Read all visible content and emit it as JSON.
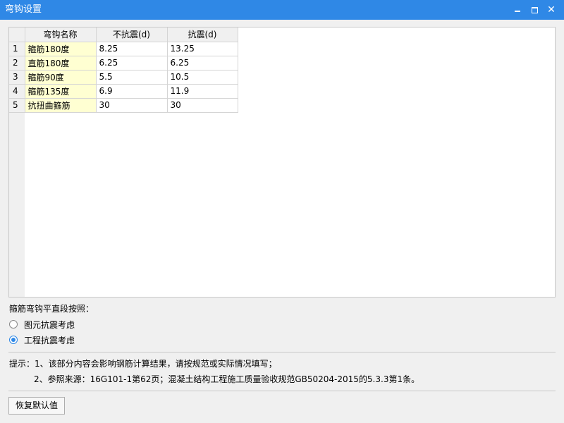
{
  "window": {
    "title": "弯钩设置",
    "minimize_icon": "minimize-icon",
    "maximize_icon": "maximize-icon",
    "close_icon": "close-icon",
    "close_glyph": "✕"
  },
  "table": {
    "columns": [
      "弯钩名称",
      "不抗震(d)",
      "抗震(d)"
    ],
    "rows": [
      {
        "no": "1",
        "name": "箍筋180度",
        "nonseismic": "8.25",
        "seismic": "13.25"
      },
      {
        "no": "2",
        "name": "直筋180度",
        "nonseismic": "6.25",
        "seismic": "6.25"
      },
      {
        "no": "3",
        "name": "箍筋90度",
        "nonseismic": "5.5",
        "seismic": "10.5"
      },
      {
        "no": "4",
        "name": "箍筋135度",
        "nonseismic": "6.9",
        "seismic": "11.9"
      },
      {
        "no": "5",
        "name": "抗扭曲箍筋",
        "nonseismic": "30",
        "seismic": "30"
      }
    ],
    "name_cell_color": "#ffffd2"
  },
  "option": {
    "label": "箍筋弯钩平直段按照：",
    "choices": [
      {
        "label": "图元抗震考虑",
        "checked": false
      },
      {
        "label": "工程抗震考虑",
        "checked": true
      }
    ],
    "accent_color": "#2f88e6"
  },
  "hints": {
    "line1": "提示：1、该部分内容会影响钢筋计算结果，请按规范或实际情况填写；",
    "line2": "2、参照来源：16G101-1第62页；混凝土结构工程施工质量验收规范GB50204-2015的5.3.3第1条。"
  },
  "buttons": {
    "restore_default": "恢复默认值"
  }
}
